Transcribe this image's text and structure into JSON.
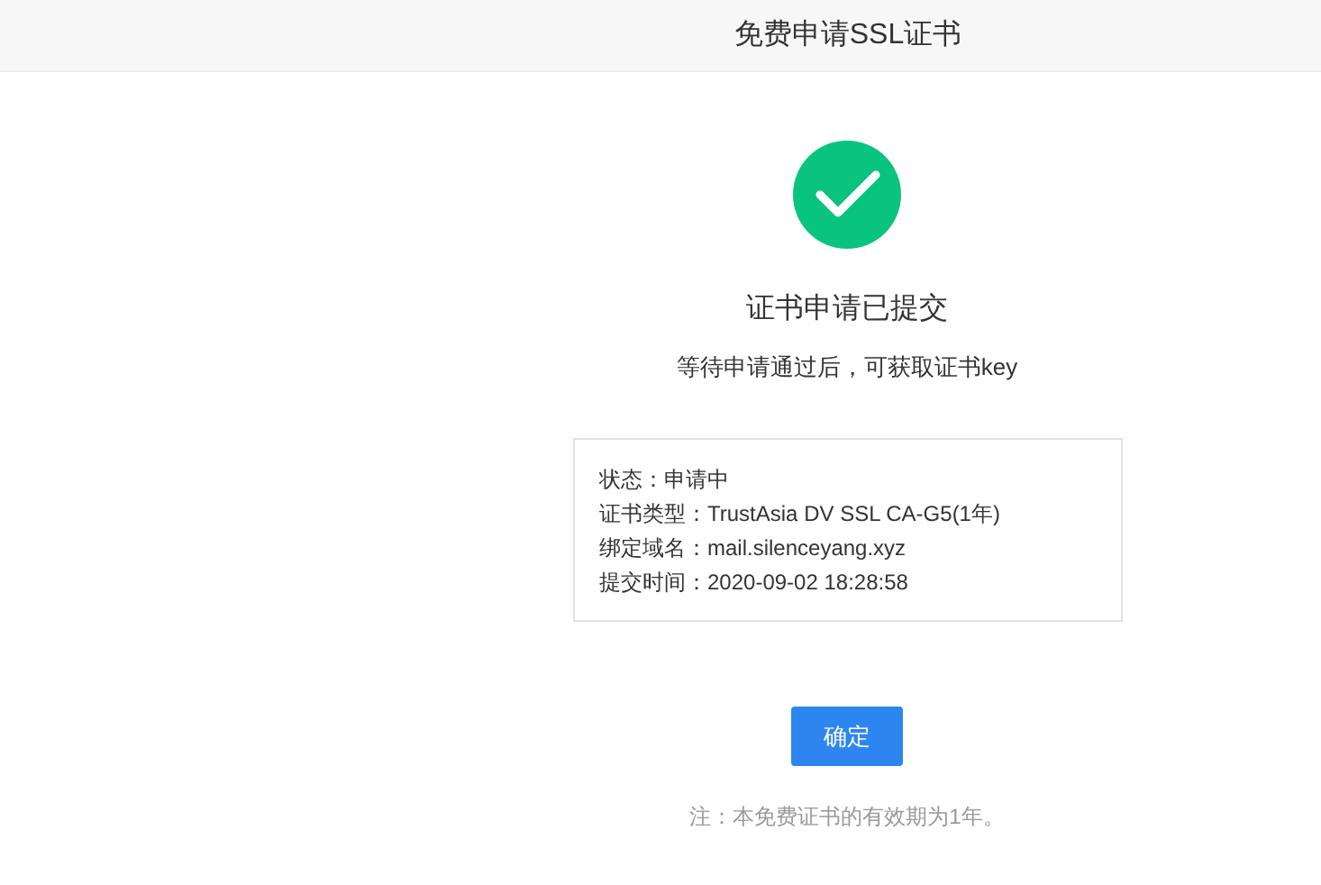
{
  "header": {
    "title": "免费申请SSL证书"
  },
  "result": {
    "success": true,
    "heading": "证书申请已提交",
    "message": "等待申请通过后，可获取证书key"
  },
  "details": [
    "状态：申请中",
    "证书类型：TrustAsia DV SSL CA-G5(1年)",
    "绑定域名：mail.silenceyang.xyz",
    "提交时间：2020-09-02 18:28:58"
  ],
  "confirm_button": {
    "label": "确定"
  },
  "note": "注：本免费证书的有效期为1年。"
}
